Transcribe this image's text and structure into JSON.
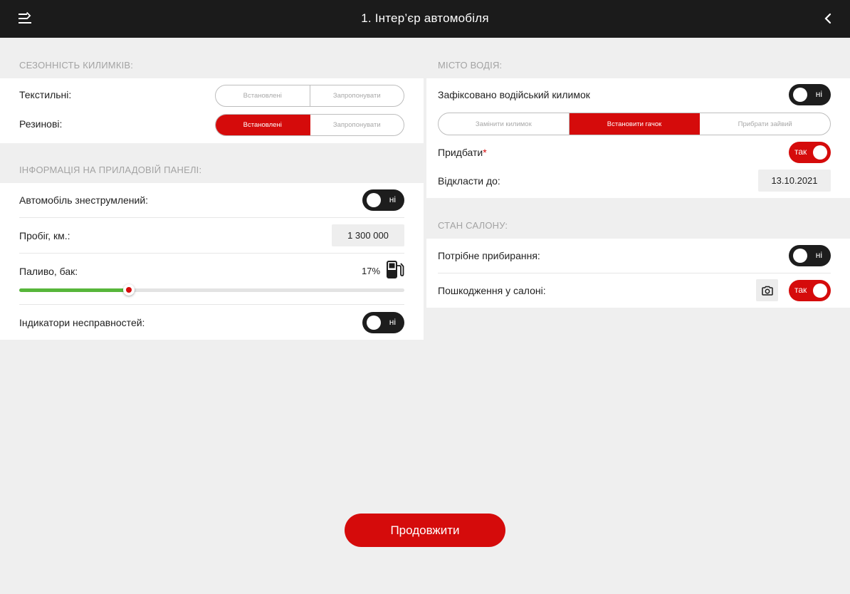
{
  "header": {
    "title": "1. Інтер’єр автомобіля"
  },
  "mats": {
    "heading": "СЕЗОННІСТЬ КИЛИМКІВ:",
    "rows": [
      {
        "label": "Текстильні:",
        "options": [
          "Встановлені",
          "Запропонувати"
        ],
        "selected": null
      },
      {
        "label": "Резинові:",
        "options": [
          "Встановлені",
          "Запропонувати"
        ],
        "selected": "Встановлені"
      }
    ]
  },
  "dashboard": {
    "heading": "ІНФОРМАЦІЯ НА ПРИЛАДОВІЙ ПАНЕЛІ:",
    "deenergized": {
      "label": "Автомобіль знеструмлений:",
      "toggle": "ні",
      "on": false
    },
    "mileage": {
      "label": "Пробіг, км.:",
      "value": "1 300 000"
    },
    "fuel": {
      "label": "Паливо, бак:",
      "value_text": "17%",
      "level": 0.17,
      "icon": "fuel-pump-icon"
    },
    "faults": {
      "label": "Індикатори несправностей:",
      "toggle": "ні",
      "on": false
    }
  },
  "driver_seat": {
    "heading": "МІСТО ВОДІЯ:",
    "mat_fixed": {
      "label": "Зафіксовано водійський килимок",
      "toggle": "ні",
      "on": false
    },
    "actions": {
      "options": [
        "Замінити килимок",
        "Встановити гачок",
        "Прибрати зайвий"
      ],
      "selected": "Встановити гачок"
    },
    "buy": {
      "label": "Придбати",
      "required_mark": "*",
      "toggle": "так",
      "on": true
    },
    "postpone": {
      "label": "Відкласти до:",
      "date": "13.10.2021"
    }
  },
  "cabin": {
    "heading": "СТАН САЛОНУ:",
    "cleaning": {
      "label": "Потрібне прибирання:",
      "toggle": "ні",
      "on": false
    },
    "damage": {
      "label": "Пошкодження у салоні:",
      "toggle": "так",
      "on": true,
      "icon": "camera-icon"
    }
  },
  "footer": {
    "continue_label": "Продовжити"
  },
  "colors": {
    "accent": "#d50b0b",
    "topbar": "#1b1b1b",
    "fuel_fill": "#57b63a",
    "background": "#efefef"
  }
}
